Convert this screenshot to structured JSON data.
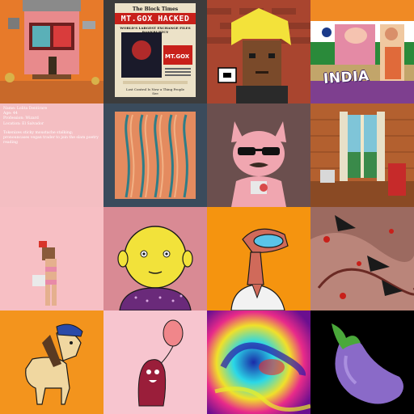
{
  "grid": {
    "tiles": [
      {
        "name": "nft-pink-house-tower",
        "bg": "#f07f2b"
      },
      {
        "name": "nft-newspaper-mtgox",
        "bg": "#3b3b3b"
      },
      {
        "name": "nft-pixel-blonde-character",
        "bg": "#b04a32"
      },
      {
        "name": "nft-india-collage",
        "bg": "#ffffff"
      },
      {
        "name": "nft-bio-text",
        "bg": "#f4bec2"
      },
      {
        "name": "nft-abstract-lines",
        "bg": "#3a4b5c"
      },
      {
        "name": "nft-cat-sunglasses",
        "bg": "#6b4f4e"
      },
      {
        "name": "nft-room-interior",
        "bg": "#c96b3a"
      },
      {
        "name": "nft-pixel-bikini-woman",
        "bg": "#f7bfc4"
      },
      {
        "name": "nft-yellow-head-sweater",
        "bg": "#d98a94"
      },
      {
        "name": "nft-lizard-robe",
        "bg": "#f5940f"
      },
      {
        "name": "nft-dark-crows-painting",
        "bg": "#a06a62"
      },
      {
        "name": "nft-horse-cap",
        "bg": "#f3941d"
      },
      {
        "name": "nft-balloon-creature",
        "bg": "#f7c5cf"
      },
      {
        "name": "nft-psychedelic-swirl",
        "bg": "#6a0f8f"
      },
      {
        "name": "nft-eggplant-emoji",
        "bg": "#000000"
      }
    ]
  },
  "newspaper": {
    "masthead": "The Block Times",
    "headline": "MT.GOX HACKED",
    "subhead": "WORLD'S LARGEST EXCHANGE FILES BANKRUPTCY",
    "badge": "MT.GOX",
    "footer": "Lost Control Is Now a Thing People See"
  },
  "india": {
    "label": "INDIA"
  },
  "bio": {
    "name": "Name: Lolita Dentirare",
    "age": "Age: 44",
    "profession": "Profession: Wizard",
    "location": "Location: El Salvador",
    "about": "Tokenizes sticky moustache stalking; pronouncases vegan trader to join the slam poetry reading"
  }
}
